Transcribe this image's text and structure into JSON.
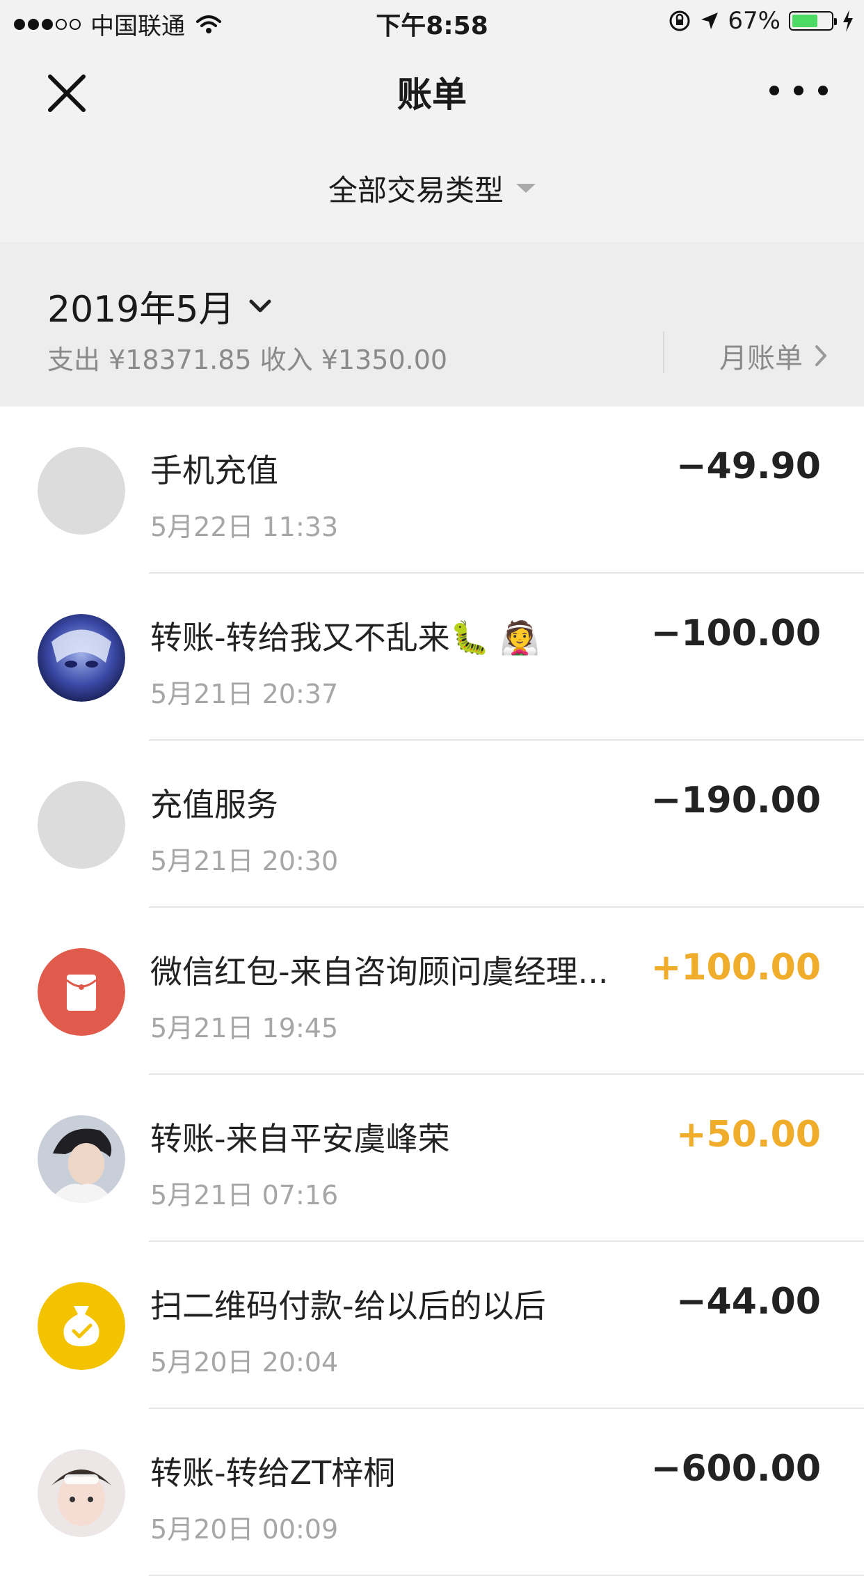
{
  "status_bar": {
    "carrier": "中国联通",
    "time": "下午8:58",
    "battery": "67%",
    "battery_level": 0.67
  },
  "nav": {
    "title": "账单"
  },
  "filter": {
    "label": "全部交易类型"
  },
  "month": {
    "title": "2019年5月",
    "summary": "支出 ¥18371.85 收入 ¥1350.00",
    "bill_link": "月账单"
  },
  "transactions": [
    {
      "title": "手机充值",
      "time": "5月22日 11:33",
      "amount": "−49.90",
      "avatar": "gray-circle"
    },
    {
      "title": "转账-转给我又不乱来🐛 👰",
      "time": "5月21日 20:37",
      "amount": "−100.00",
      "avatar": "anime-avatar"
    },
    {
      "title": "充值服务",
      "time": "5月21日 20:30",
      "amount": "−190.00",
      "avatar": "gray-circle"
    },
    {
      "title": "微信红包-来自咨询顾问虞经理...",
      "time": "5月21日 19:45",
      "amount": "+100.00",
      "avatar": "red-packet-icon"
    },
    {
      "title": "转账-来自平安虞峰荣",
      "time": "5月21日 07:16",
      "amount": "+50.00",
      "avatar": "person-avatar"
    },
    {
      "title": "扫二维码付款-给以后的以后",
      "time": "5月20日 20:04",
      "amount": "−44.00",
      "avatar": "money-bag-icon"
    },
    {
      "title": "转账-转给ZT梓桐",
      "time": "5月20日 00:09",
      "amount": "−600.00",
      "avatar": "child-avatar"
    }
  ],
  "colors": {
    "income": "#f0ad2b",
    "red_packet": "#e05b4b",
    "money_bag": "#f3c300"
  }
}
